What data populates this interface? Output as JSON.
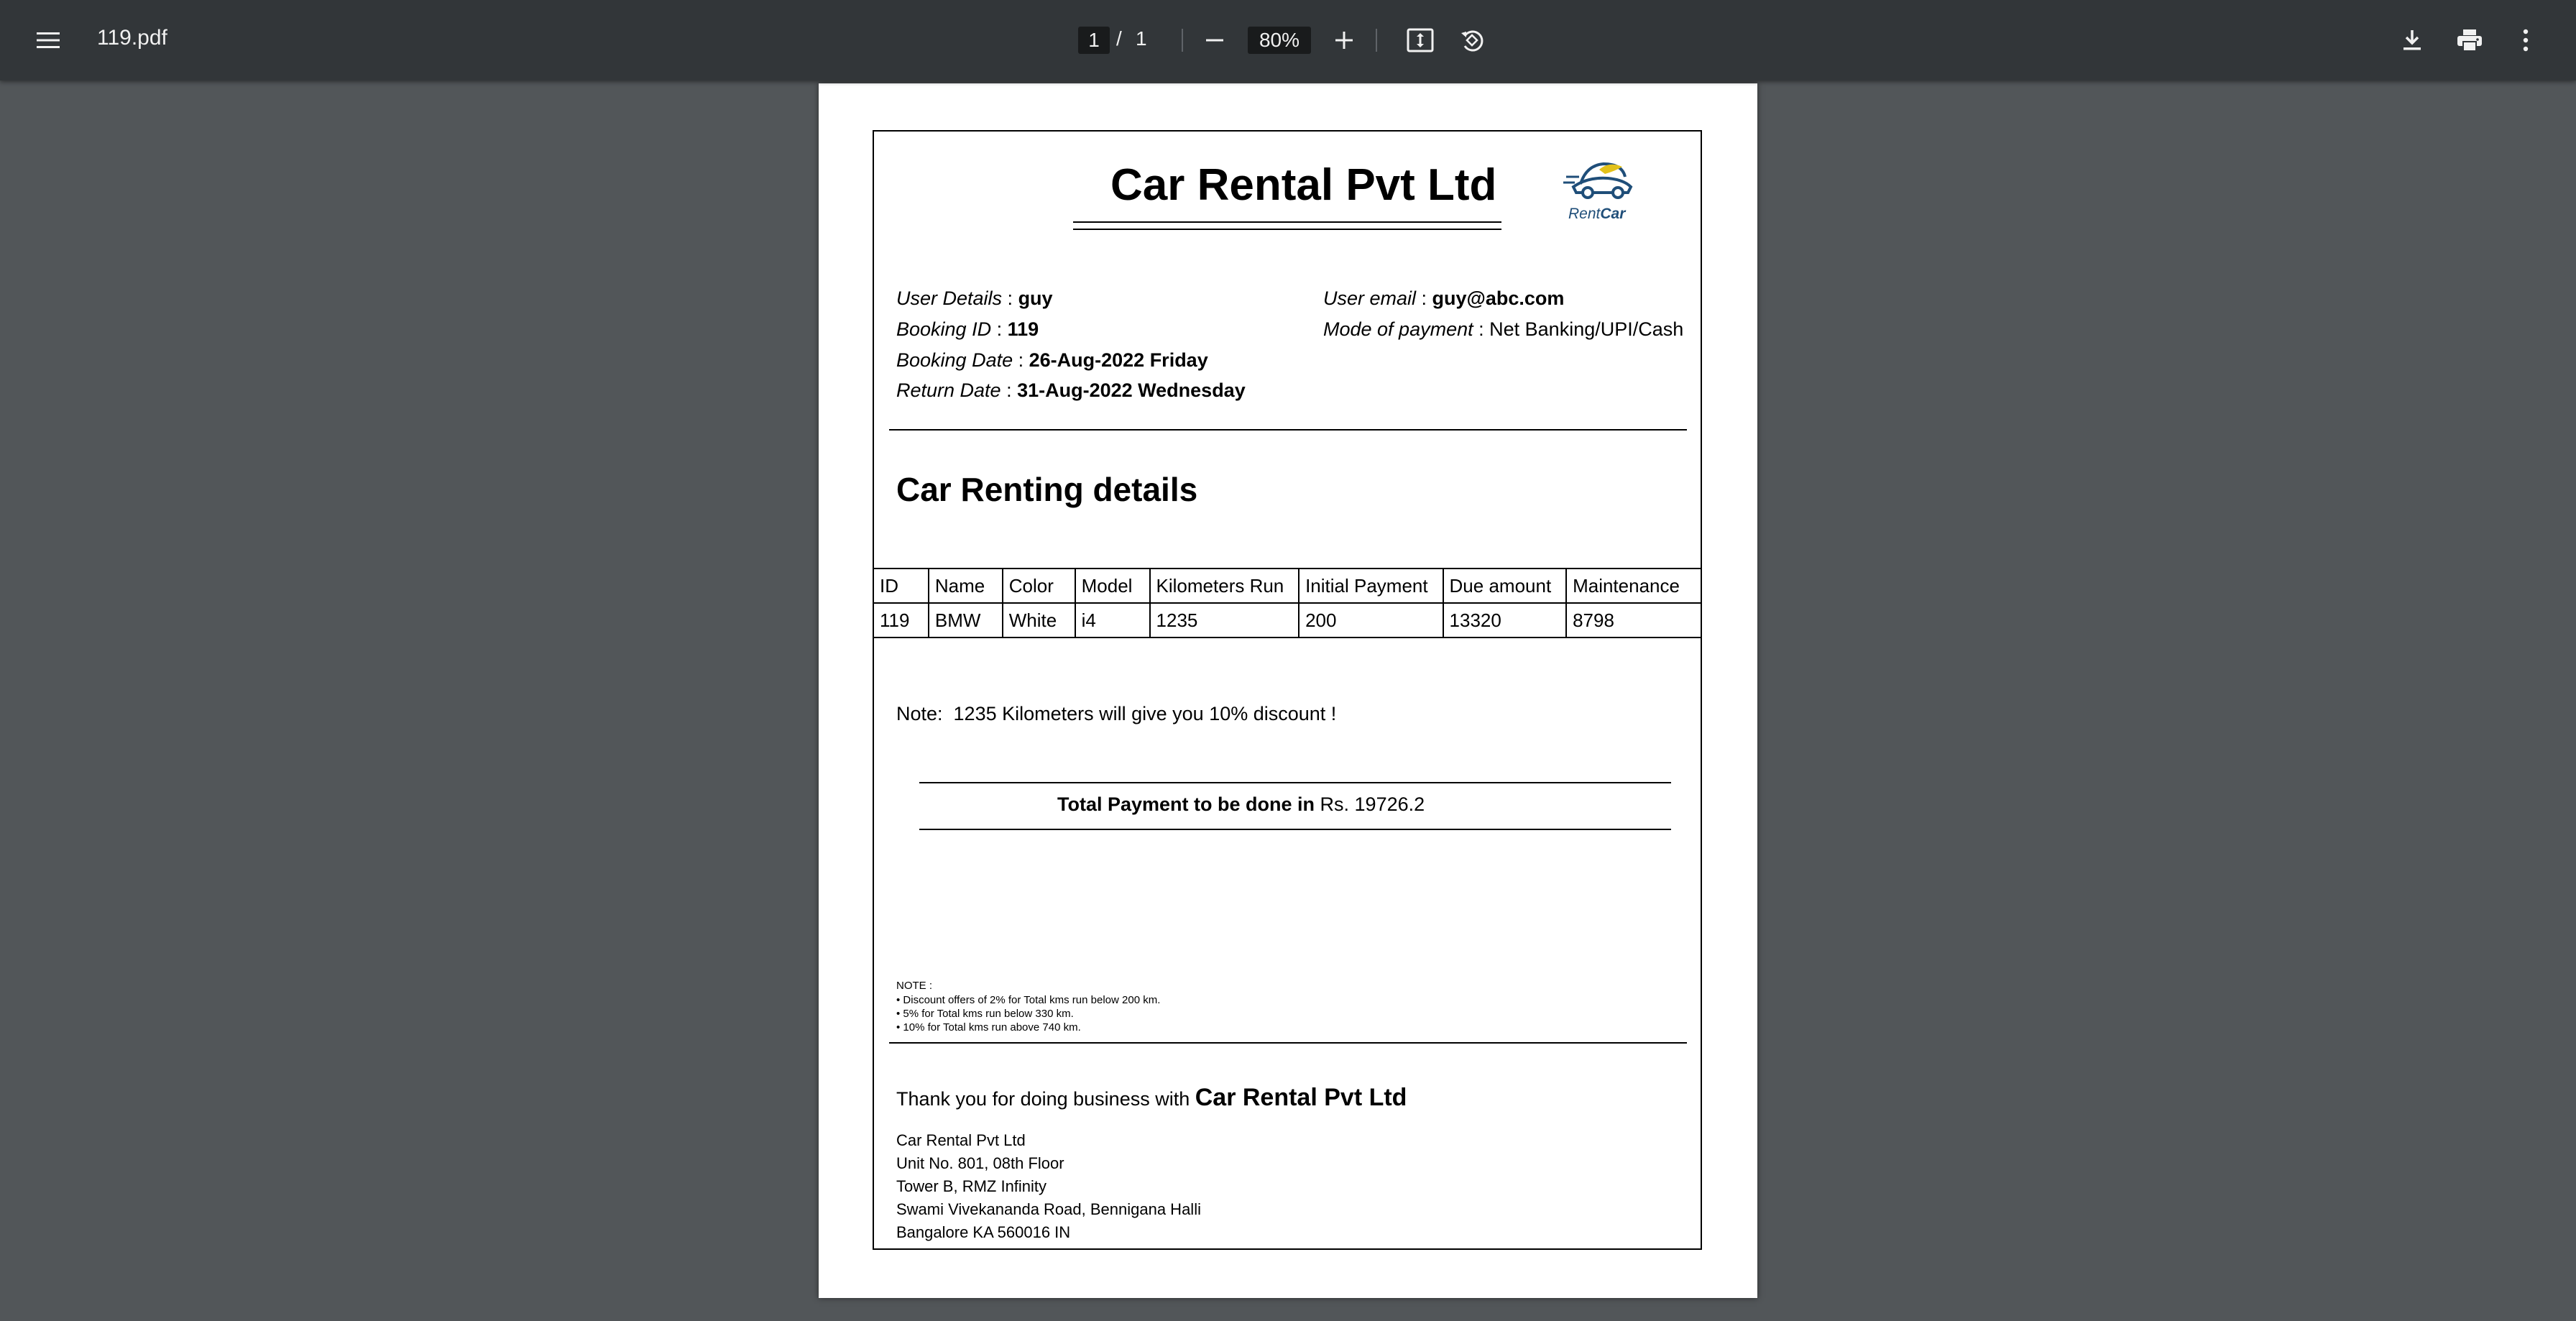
{
  "toolbar": {
    "file_name": "119.pdf",
    "current_page": "1",
    "page_separator": "/",
    "total_pages": "1",
    "zoom": "80%",
    "icons": {
      "menu": "menu-icon",
      "zoom_out": "minus-icon",
      "zoom_in": "plus-icon",
      "fit": "fit-to-page-icon",
      "rotate": "rotate-icon",
      "download": "download-icon",
      "print": "print-icon",
      "more": "more-vert-icon"
    }
  },
  "document": {
    "company_title": "Car Rental Pvt Ltd",
    "logo": {
      "text_rent": "Rent",
      "text_car": "Car"
    },
    "details": {
      "user_details_label": "User Details",
      "user_details_sep": " : ",
      "user_details_value": "guy",
      "booking_id_label": "Booking ID",
      "booking_id_sep": " : ",
      "booking_id_value": "119",
      "booking_date_label": "Booking Date",
      "booking_date_sep": " : ",
      "booking_date_value": "26-Aug-2022 Friday",
      "return_date_label": "Return Date",
      "return_date_sep": " : ",
      "return_date_value": "31-Aug-2022 Wednesday",
      "user_email_label": "User email",
      "user_email_sep": " : ",
      "user_email_value": "guy@abc.com",
      "payment_mode_label": "Mode of payment",
      "payment_mode_sep": " : ",
      "payment_mode_value": "Net Banking/UPI/Cash"
    },
    "section_title": "Car Renting details",
    "table": {
      "headers": [
        "ID",
        "Name",
        "Color",
        "Model",
        "Kilometers Run",
        "Initial Payment",
        "Due amount",
        "Maintenance"
      ],
      "rows": [
        [
          "119",
          "BMW",
          "White",
          "i4",
          "1235",
          "200",
          "13320",
          "8798"
        ]
      ]
    },
    "note": "Note:  1235 Kilometers will give you 10% discount !",
    "payment": {
      "label": "Total Payment to be done in",
      "value": " Rs. 19726.2"
    },
    "discount_notes": {
      "heading": "NOTE :",
      "lines": [
        "• Discount offers of 2% for Total kms run below 200 km.",
        "• 5% for Total kms run below 330 km.",
        "• 10% for Total kms run above 740 km."
      ]
    },
    "thanks_prefix": "Thank you for doing business with ",
    "thanks_company": "Car Rental Pvt Ltd",
    "address": [
      "Car Rental Pvt Ltd",
      "Unit No. 801, 08th Floor",
      "Tower B, RMZ Infinity",
      "Swami Vivekananda Road, Bennigana Halli",
      "Bangalore KA 560016 IN"
    ]
  }
}
